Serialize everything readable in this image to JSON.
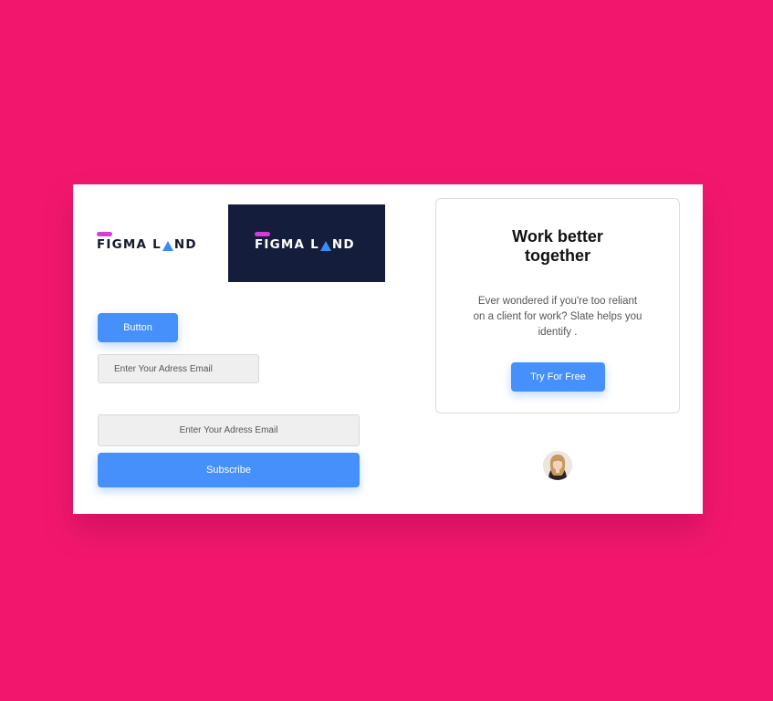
{
  "brand": {
    "logo_text_pre": "FIGMA L",
    "logo_text_post": "ND",
    "mark_color": "#d63ad9",
    "triangle_color": "#3a8cf5",
    "dark_panel_color": "#141d3b"
  },
  "colors": {
    "background": "#f2176d",
    "primary": "#4590fb"
  },
  "buttons": {
    "button_label": "Button",
    "subscribe_label": "Subscribe",
    "try_label": "Try For Free"
  },
  "inputs": {
    "email_short_placeholder": "Enter Your Adress Email",
    "email_wide_placeholder": "Enter Your Adress Email"
  },
  "promo": {
    "title": "Work better together",
    "body": "Ever wondered if you're too reliant on a client for work? Slate helps you identify ."
  },
  "avatar": {
    "icon": "user-avatar"
  }
}
